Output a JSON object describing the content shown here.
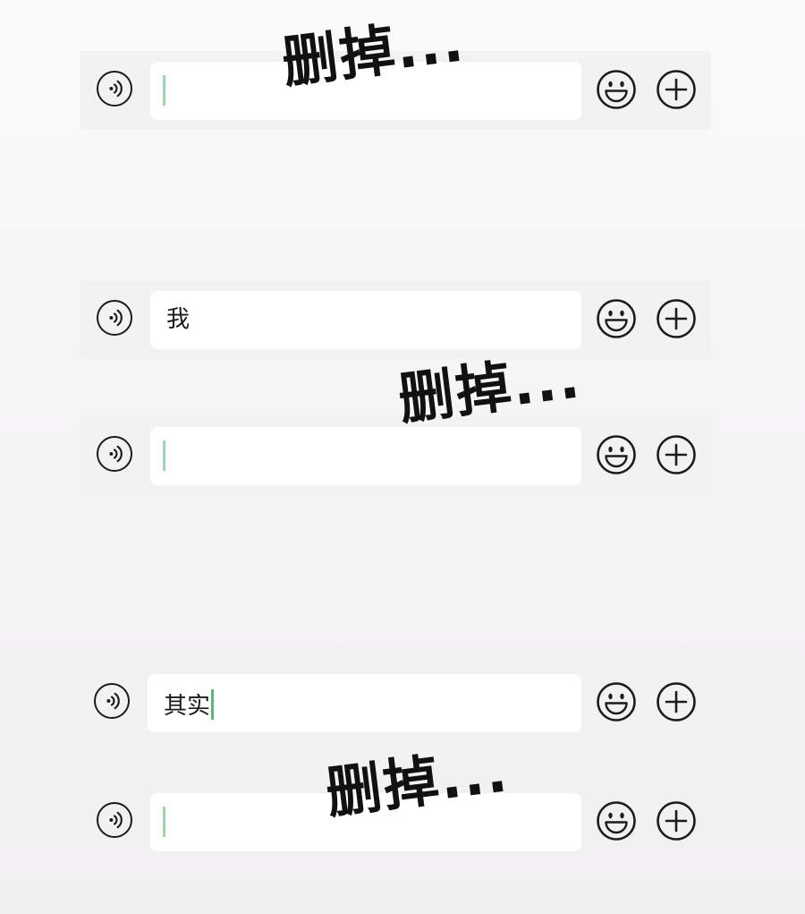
{
  "caption": "删掉...",
  "colors": {
    "bar_background": "#f3f2f3",
    "field_background": "#ffffff",
    "caret": "#9bd7ad",
    "caret_active": "#58b97a",
    "icon_stroke": "#1c1c1c"
  },
  "icons": {
    "voice": "voice-icon",
    "emoji": "emoji-icon",
    "more": "plus-icon"
  },
  "bars": [
    {
      "text": ""
    },
    {
      "text": "我"
    },
    {
      "text": ""
    },
    {
      "text": "其实"
    },
    {
      "text": ""
    }
  ]
}
